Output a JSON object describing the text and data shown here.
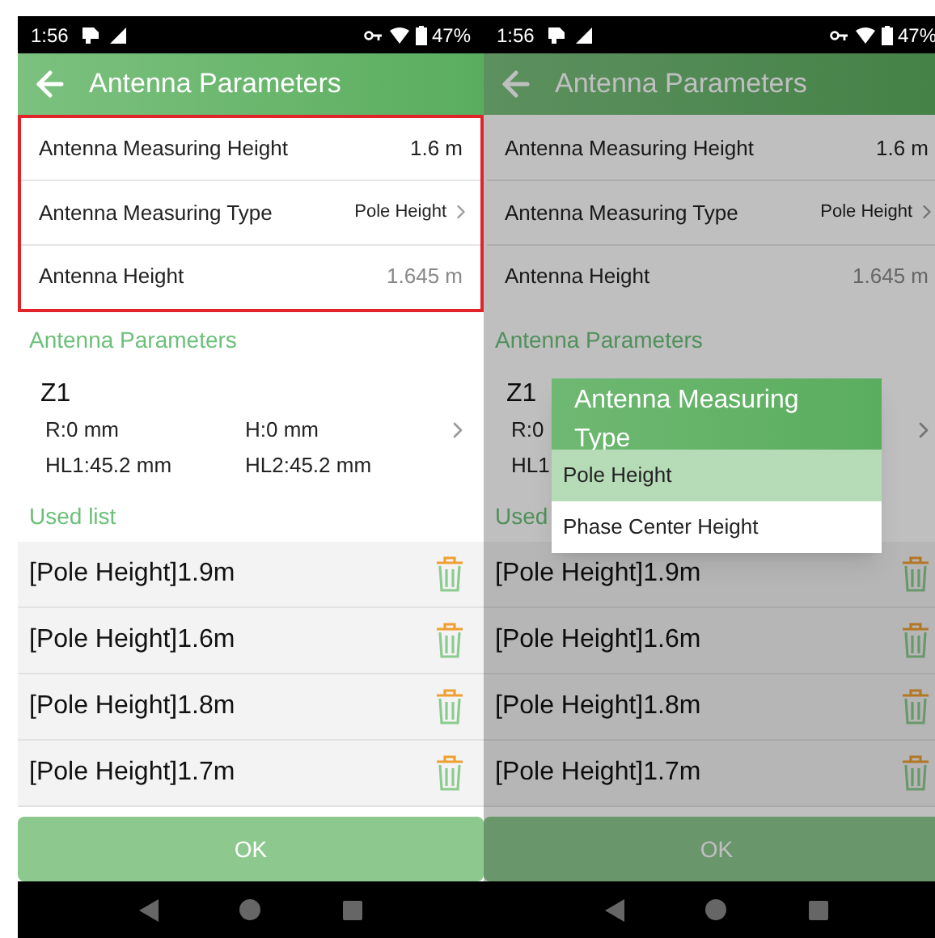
{
  "screens": [
    {
      "dimmed": false,
      "status_bar": {
        "time": "1:56",
        "battery": "47%"
      },
      "header": {
        "title": "Antenna Parameters"
      },
      "settings": {
        "highlighted": true,
        "rows": [
          {
            "label": "Antenna Measuring Height",
            "value": "1.6 m",
            "kind": "value"
          },
          {
            "label": "Antenna Measuring Type",
            "value": "Pole Height",
            "kind": "select"
          },
          {
            "label": "Antenna Height",
            "value": "1.645 m",
            "kind": "readonly"
          }
        ]
      },
      "section_title": "Antenna Parameters",
      "antenna": {
        "name": "Z1",
        "fields": [
          [
            "R:0 mm",
            "H:0 mm"
          ],
          [
            "HL1:45.2 mm",
            "HL2:45.2 mm"
          ]
        ]
      },
      "used_list_title": "Used list",
      "used_list": [
        "[Pole Height]1.9m",
        "[Pole Height]1.6m",
        "[Pole Height]1.8m",
        "[Pole Height]1.7m"
      ],
      "ok_button": "OK"
    },
    {
      "dimmed": true,
      "status_bar": {
        "time": "1:56",
        "battery": "47%"
      },
      "header": {
        "title": "Antenna Parameters"
      },
      "settings": {
        "highlighted": false,
        "rows": [
          {
            "label": "Antenna Measuring Height",
            "value": "1.6 m",
            "kind": "value"
          },
          {
            "label": "Antenna Measuring Type",
            "value": "Pole Height",
            "kind": "select"
          },
          {
            "label": "Antenna Height",
            "value": "1.645 m",
            "kind": "readonly"
          }
        ]
      },
      "section_title": "Antenna Parameters",
      "antenna": {
        "name": "Z1",
        "fields": [
          [
            "R:0"
          ],
          [
            "HL1"
          ]
        ]
      },
      "used_list_title": "Used",
      "used_list": [
        "[Pole Height]1.9m",
        "[Pole Height]1.6m",
        "[Pole Height]1.8m",
        "[Pole Height]1.7m"
      ],
      "ok_button": "OK",
      "dialog": {
        "title": "Antenna Measuring Type",
        "options": [
          {
            "label": "Pole Height",
            "selected": true
          },
          {
            "label": "Phase Center Height",
            "selected": false
          }
        ]
      }
    }
  ]
}
